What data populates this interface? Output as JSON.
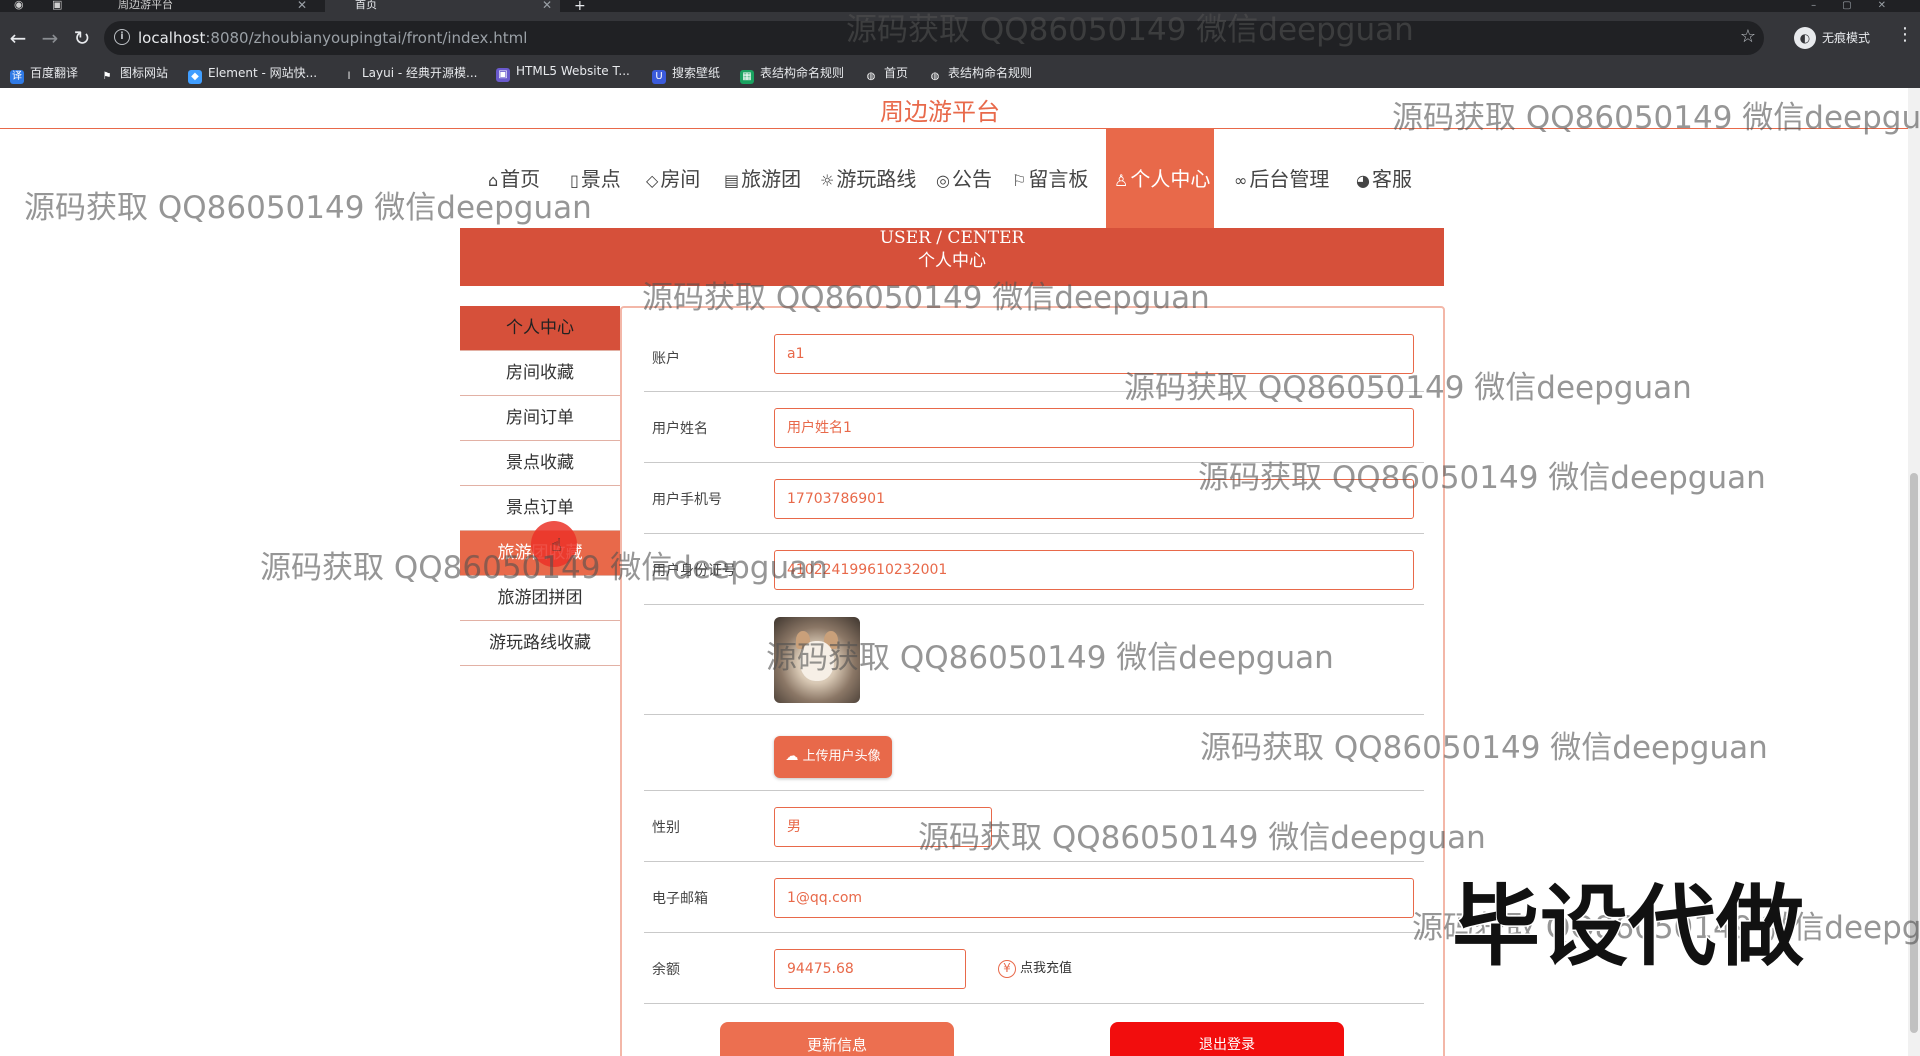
{
  "browser": {
    "tabs": [
      {
        "label": "周边游平台"
      },
      {
        "label": "首页"
      }
    ],
    "url_host": "localhost",
    "url_rest": ":8080/zhoubianyoupingtai/front/index.html",
    "incognito_label": "无痕模式",
    "bookmarks": [
      {
        "label": "百度翻译"
      },
      {
        "label": "图标网站"
      },
      {
        "label": "Element - 网站快..."
      },
      {
        "label": "Layui - 经典开源模..."
      },
      {
        "label": "HTML5 Website T..."
      },
      {
        "label": "搜索壁纸"
      },
      {
        "label": "表结构命名规则"
      },
      {
        "label": "首页"
      },
      {
        "label": "表结构命名规则"
      }
    ]
  },
  "site": {
    "title": "周边游平台",
    "accent_color": "#e8694a",
    "nav": [
      {
        "icon": "⌂",
        "label": "首页"
      },
      {
        "icon": "▯",
        "label": "景点"
      },
      {
        "icon": "◇",
        "label": "房间"
      },
      {
        "icon": "▤",
        "label": "旅游团"
      },
      {
        "icon": "☼",
        "label": "游玩路线"
      },
      {
        "icon": "◎",
        "label": "公告"
      },
      {
        "icon": "⚐",
        "label": "留言板"
      },
      {
        "icon": "♙",
        "label": "个人中心"
      },
      {
        "icon": "∞",
        "label": "后台管理"
      },
      {
        "icon": "◕",
        "label": "客服"
      }
    ]
  },
  "banner": {
    "en": "USER / CENTER",
    "cn": "个人中心"
  },
  "sidebar": {
    "items": [
      {
        "label": "个人中心"
      },
      {
        "label": "房间收藏"
      },
      {
        "label": "房间订单"
      },
      {
        "label": "景点收藏"
      },
      {
        "label": "景点订单"
      },
      {
        "label": "旅游团收藏"
      },
      {
        "label": "旅游团拼团"
      },
      {
        "label": "游玩路线收藏"
      }
    ]
  },
  "form": {
    "account_label": "账户",
    "account_value": "a1",
    "name_label": "用户姓名",
    "name_value": "用户姓名1",
    "phone_label": "用户手机号",
    "phone_value": "17703786901",
    "idcard_label": "用户身份证号",
    "idcard_value": "410224199610232001",
    "upload_label": "上传用户头像",
    "gender_label": "性别",
    "gender_value": "男",
    "email_label": "电子邮箱",
    "email_value": "1@qq.com",
    "balance_label": "余额",
    "balance_value": "94475.68",
    "recharge_label": "点我充值",
    "update_button": "更新信息",
    "logout_button": "退出登录"
  },
  "watermark": {
    "text": "源码获取 QQ86050149 微信deepguan",
    "stamp": "毕设代做"
  }
}
